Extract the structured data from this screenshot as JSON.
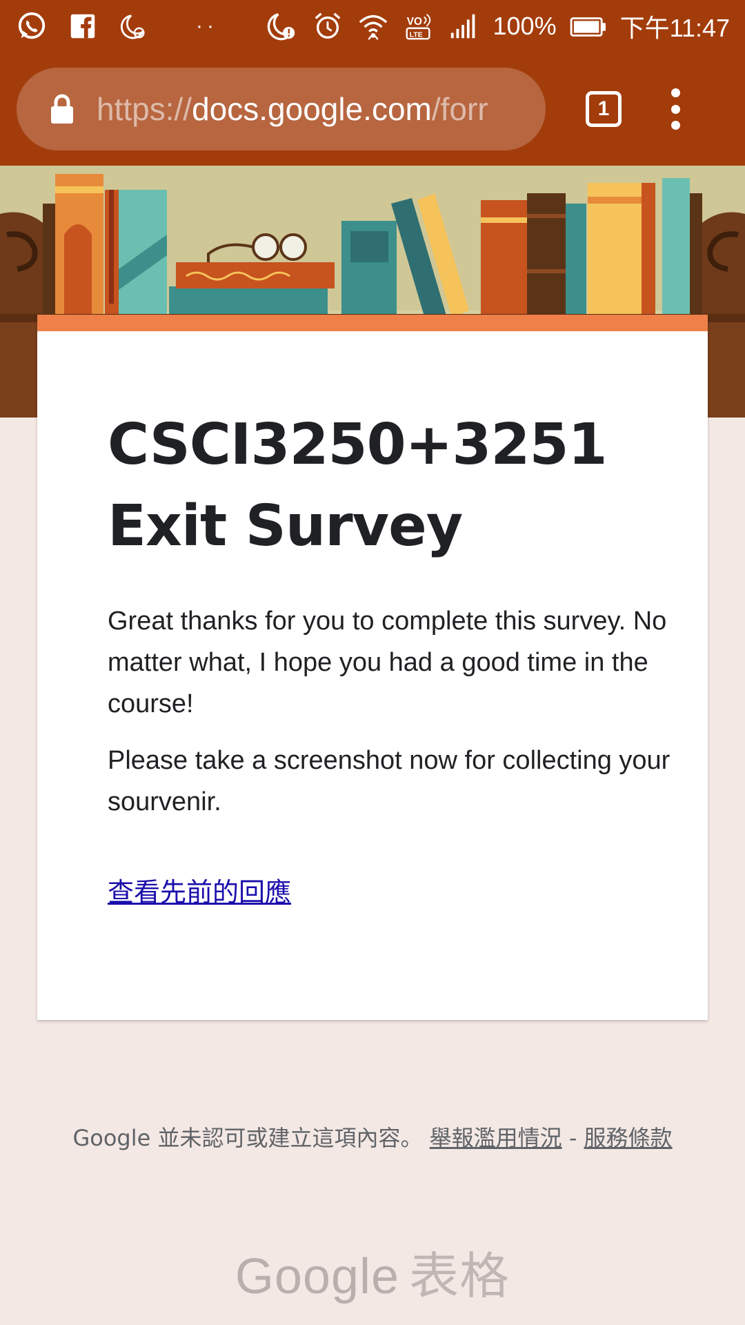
{
  "status_bar": {
    "battery": "100%",
    "time": "下午11:47",
    "dots": "··"
  },
  "browser": {
    "url_scheme": "https://",
    "url_host": "docs.google.com",
    "url_path": "/forr",
    "tab_count": "1"
  },
  "form": {
    "title": "CSCI3250+3251 Exit Survey",
    "description": [
      "Great thanks for you to complete this survey. No matter what, I hope you had a good time in the course!",
      "Please take a screenshot now for collecting your sourvenir."
    ],
    "view_previous_link": "查看先前的回應"
  },
  "footer": {
    "disclaimer": "Google 並未認可或建立這項內容。",
    "report_abuse": "舉報濫用情況",
    "separator": "-",
    "terms": "服務條款"
  },
  "branding": {
    "google": "Google",
    "product": "表格"
  },
  "colors": {
    "toolbar": "#a33c0b",
    "accent": "#f0804a",
    "page_bg": "#f4e8e4",
    "link": "#1a0dab"
  }
}
